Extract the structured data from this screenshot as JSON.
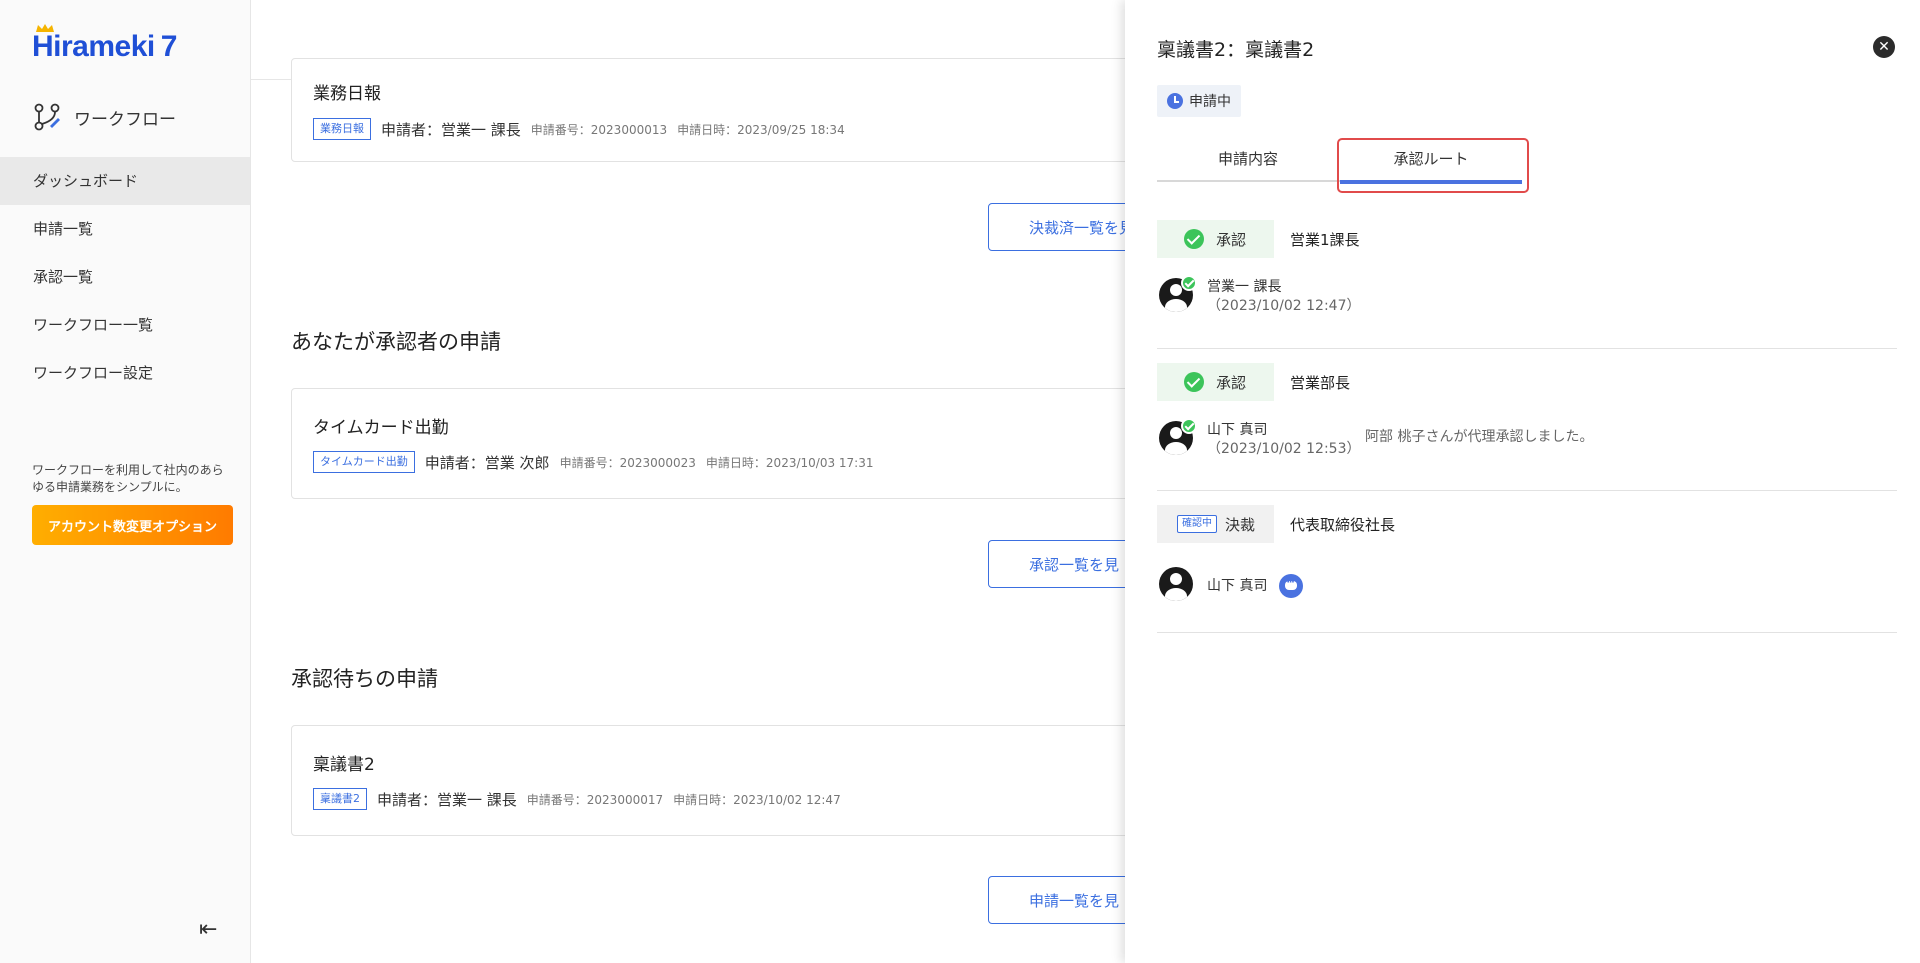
{
  "sidebar": {
    "logo_text": "Hirameki",
    "logo_number": "7",
    "app_title": "ワークフロー",
    "items": [
      {
        "label": "ダッシュボード"
      },
      {
        "label": "申請一覧"
      },
      {
        "label": "承認一覧"
      },
      {
        "label": "ワークフロー一覧"
      },
      {
        "label": "ワークフロー設定"
      }
    ],
    "promo_text": "ワークフローを利用して社内のあらゆる申請業務をシンプルに。",
    "promo_button": "アカウント数変更オプション",
    "collapse_icon": "collapse-left-icon"
  },
  "main": {
    "card_top": {
      "title": "業務日報",
      "tag": "業務日報",
      "applicant": "申請者：営業一 課長",
      "number": "申請番号：2023000013",
      "date": "申請日時：2023/09/25 18:34"
    },
    "btn_decided": "決裁済一覧を見",
    "section_approver": "あなたが承認者の申請",
    "card_mid": {
      "title": "タイムカード出勤",
      "tag": "タイムカード出勤",
      "applicant": "申請者：営業 次郎",
      "number": "申請番号：2023000023",
      "date": "申請日時：2023/10/03 17:31"
    },
    "btn_approval": "承認一覧を見",
    "section_waiting": "承認待ちの申請",
    "card_bottom": {
      "title": "稟議書2",
      "tag": "稟議書2",
      "applicant": "申請者：営業一 課長",
      "number": "申請番号：2023000017",
      "date": "申請日時：2023/10/02 12:47"
    },
    "btn_application": "申請一覧を見"
  },
  "drawer": {
    "title": "稟議書2：稟議書2",
    "status": "申請中",
    "tabs": [
      {
        "label": "申請内容"
      },
      {
        "label": "承認ルート"
      }
    ],
    "active_tab": "承認ルート",
    "steps": [
      {
        "status": "承認",
        "role": "営業1課長",
        "person": "営業一 課長",
        "date": "（2023/10/02 12:47）"
      },
      {
        "status": "承認",
        "role": "営業部長",
        "person": "山下 真司",
        "date": "（2023/10/02 12:53）",
        "note": "阿部 桃子さんが代理承認しました。"
      },
      {
        "status": "決裁",
        "status_tag": "確認中",
        "role": "代表取締役社長",
        "person": "山下 真司"
      }
    ]
  },
  "colors": {
    "accent": "#3b6fe0",
    "approved_green": "#3cc45a",
    "promo_orange": "#ff8a00",
    "highlight_red": "#e14b4b"
  }
}
